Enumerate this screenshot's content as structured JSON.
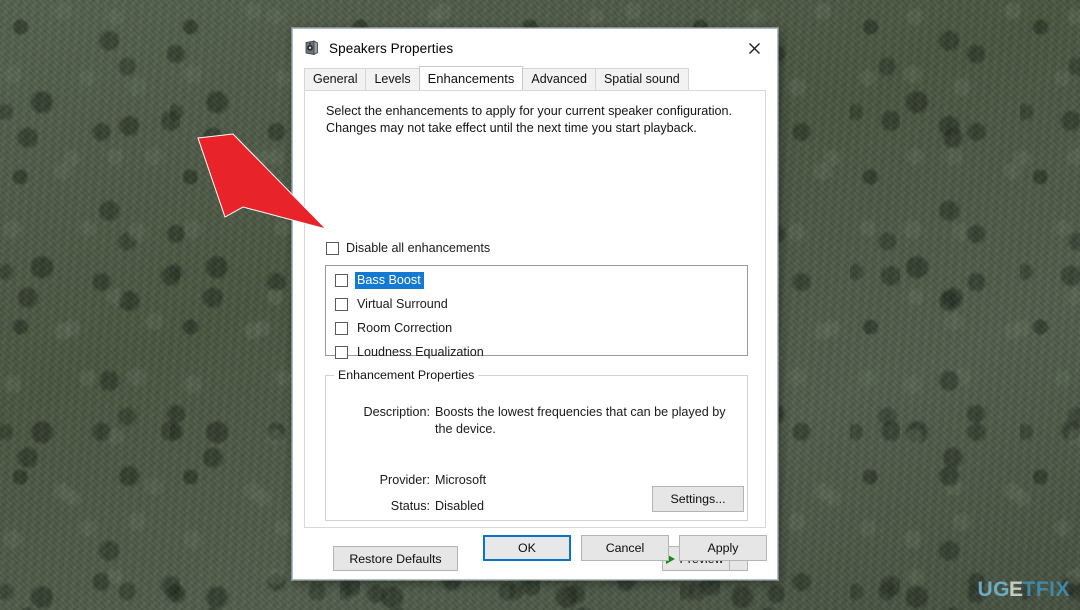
{
  "window": {
    "title": "Speakers Properties",
    "icon": "speaker-icon",
    "close_label": "Close",
    "close_glyph": "✕"
  },
  "tabs": [
    {
      "label": "General",
      "active": false
    },
    {
      "label": "Levels",
      "active": false
    },
    {
      "label": "Enhancements",
      "active": true
    },
    {
      "label": "Advanced",
      "active": false
    },
    {
      "label": "Spatial sound",
      "active": false
    }
  ],
  "enhancements_tab": {
    "intro_text": "Select the enhancements to apply for your current speaker configuration. Changes may not take effect until the next time you start playback.",
    "disable_all": {
      "label": "Disable all enhancements",
      "checked": false
    },
    "enhancement_list": [
      {
        "label": "Bass Boost",
        "checked": false,
        "selected": true
      },
      {
        "label": "Virtual Surround",
        "checked": false,
        "selected": false
      },
      {
        "label": "Room Correction",
        "checked": false,
        "selected": false
      },
      {
        "label": "Loudness Equalization",
        "checked": false,
        "selected": false
      }
    ],
    "properties_group": {
      "legend": "Enhancement Properties",
      "description_label": "Description:",
      "description_value": "Boosts the lowest frequencies that can be played by the device.",
      "provider_label": "Provider:",
      "provider_value": "Microsoft",
      "status_label": "Status:",
      "status_value": "Disabled",
      "settings_button": "Settings..."
    },
    "restore_defaults_button": "Restore Defaults",
    "preview_button": "Preview",
    "preview_dropdown_glyph": "▼"
  },
  "footer": {
    "ok": "OK",
    "cancel": "Cancel",
    "apply": "Apply"
  },
  "annotation": {
    "arrow_color": "#e8232a",
    "arrow_points_to": "Bass Boost checkbox"
  },
  "watermark": {
    "part1": "UG",
    "part2": "E",
    "part3": "TFIX",
    "full": "UGETFIX"
  },
  "colors": {
    "selection_blue": "#1479d1",
    "focus_blue": "#0a74c8",
    "play_green": "#128c12",
    "desktop_green": "#4e5b48"
  }
}
